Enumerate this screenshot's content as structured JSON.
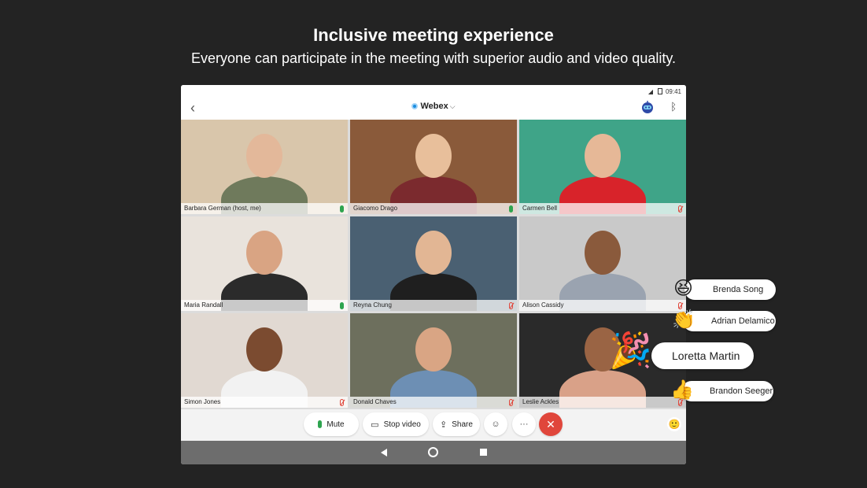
{
  "banner": {
    "headline": "Inclusive meeting experience",
    "subline": "Everyone can participate in the meeting with superior audio and video quality."
  },
  "status_bar": {
    "time": "09:41"
  },
  "app_bar": {
    "title": "Webex",
    "back_icon": "chevron-left-icon",
    "bot_icon": "assistant-bot-icon",
    "bluetooth_icon": "bluetooth-icon"
  },
  "participants": [
    {
      "name": "Barbara German (host, me)",
      "mic": "on",
      "active": true,
      "bg": "#d9c6ab",
      "skin": "#e3b89a",
      "shirt": "#6f7a5c"
    },
    {
      "name": "Giacomo Drago",
      "mic": "on",
      "active": false,
      "bg": "#8a5a3a",
      "skin": "#e8bf9b",
      "shirt": "#7b2a2e"
    },
    {
      "name": "Carmen Bell",
      "mic": "off",
      "active": false,
      "bg": "#3fa488",
      "skin": "#e6b897",
      "shirt": "#d8232a"
    },
    {
      "name": "Maria Randall",
      "mic": "on",
      "active": false,
      "bg": "#e9e3dc",
      "skin": "#d9a483",
      "shirt": "#2b2b2b"
    },
    {
      "name": "Reyna Chung",
      "mic": "off",
      "active": false,
      "bg": "#4a6072",
      "skin": "#e2b694",
      "shirt": "#1f1f1f"
    },
    {
      "name": "Alison Cassidy",
      "mic": "off",
      "active": false,
      "bg": "#c9c9c9",
      "skin": "#8a5a3c",
      "shirt": "#9aa3b0"
    },
    {
      "name": "Simon Jones",
      "mic": "off",
      "active": false,
      "bg": "#e1d9d2",
      "skin": "#7b4b30",
      "shirt": "#f2f2f2"
    },
    {
      "name": "Donald Chaves",
      "mic": "off",
      "active": false,
      "bg": "#6d6f5d",
      "skin": "#d9a584",
      "shirt": "#6d8fb4"
    },
    {
      "name": "Leslie Ackles",
      "mic": "off",
      "active": false,
      "bg": "#2a2a2a",
      "skin": "#9a6444",
      "shirt": "#d9a188"
    }
  ],
  "controls": {
    "mute_label": "Mute",
    "stop_video_label": "Stop video",
    "share_label": "Share",
    "participants_icon": "person-icon",
    "more_label": "···",
    "end_icon": "close-icon",
    "reactions_icon": "emoji-icon"
  },
  "reactions": [
    {
      "name": "Brenda Song",
      "emoji": "😆"
    },
    {
      "name": "Adrian Delamico",
      "emoji": "👏"
    },
    {
      "name": "Loretta Martin",
      "emoji": "🎉"
    },
    {
      "name": "Brandon Seeger",
      "emoji": "👍"
    }
  ],
  "colors": {
    "background": "#232323",
    "active_outline": "#3cc3e6",
    "mic_on": "#2ea44f",
    "end_call": "#e0463b",
    "webex_blue": "#1a8de0"
  }
}
